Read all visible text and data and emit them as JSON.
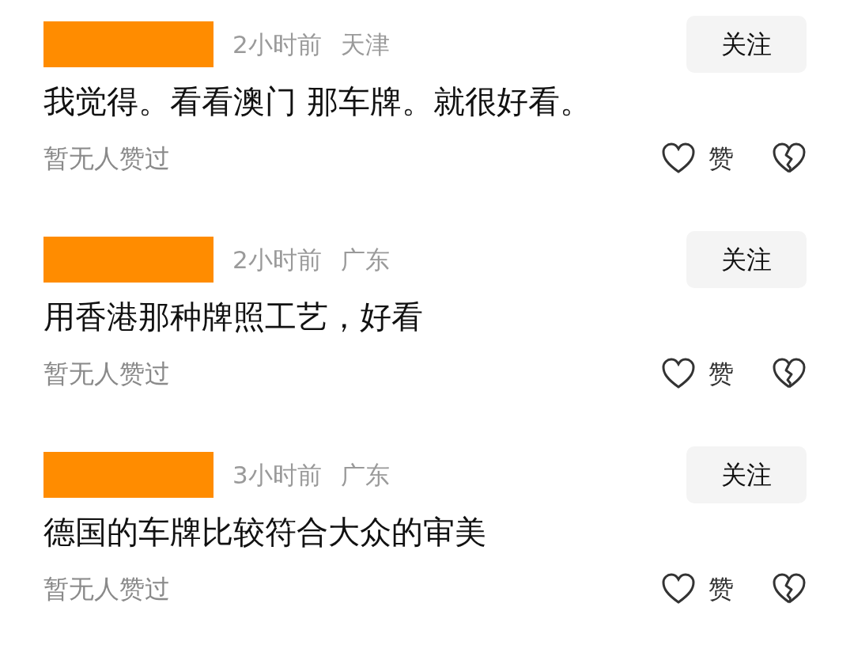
{
  "comments": [
    {
      "time": "2小时前",
      "location": "天津",
      "follow": "关注",
      "text": "我觉得。看看澳门 那车牌。就很好看。",
      "likes": "暂无人赞过",
      "like_label": "赞"
    },
    {
      "time": "2小时前",
      "location": "广东",
      "follow": "关注",
      "text": "用香港那种牌照工艺，好看",
      "likes": "暂无人赞过",
      "like_label": "赞"
    },
    {
      "time": "3小时前",
      "location": "广东",
      "follow": "关注",
      "text": "德国的车牌比较符合大众的审美",
      "likes": "暂无人赞过",
      "like_label": "赞"
    }
  ]
}
